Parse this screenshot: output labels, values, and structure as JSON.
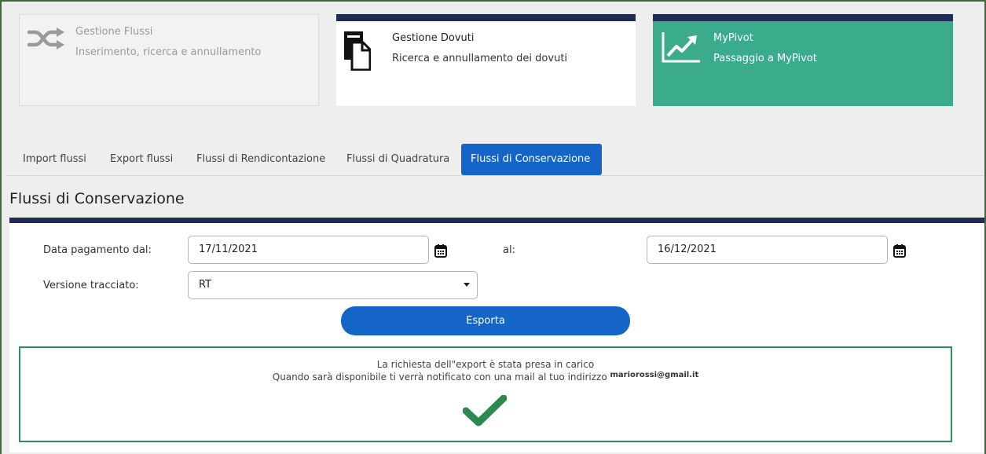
{
  "tiles": [
    {
      "title": "Gestione Flussi",
      "subtitle": "Inserimento, ricerca e annullamento",
      "icon": "shuffle-icon"
    },
    {
      "title": "Gestione Dovuti",
      "subtitle": "Ricerca e annullamento dei dovuti",
      "icon": "documents-icon"
    },
    {
      "title": "MyPivot",
      "subtitle": "Passaggio a MyPivot",
      "icon": "trending-chart-icon"
    }
  ],
  "tabs": [
    "Import flussi",
    "Export flussi",
    "Flussi di Rendicontazione",
    "Flussi di Quadratura",
    "Flussi di Conservazione"
  ],
  "active_tab": "Flussi di Conservazione",
  "section_title": "Flussi di Conservazione",
  "form": {
    "date_from_label": "Data pagamento dal:",
    "date_from_value": "17/11/2021",
    "date_to_label": "al:",
    "date_to_value": "16/12/2021",
    "version_label": "Versione tracciato:",
    "version_value": "RT",
    "export_button": "Esporta"
  },
  "message": {
    "line1": "La richiesta dell\"export è stata presa in carico",
    "line2": "Quando sarà disponibile ti verrà notificato con una mail al tuo indirizzo",
    "email": "mariorossi@gmail.it"
  },
  "colors": {
    "navy": "#1f2d55",
    "primary_blue": "#1565c8",
    "teal_tile": "#3aac8c",
    "success_green": "#2a9157"
  }
}
